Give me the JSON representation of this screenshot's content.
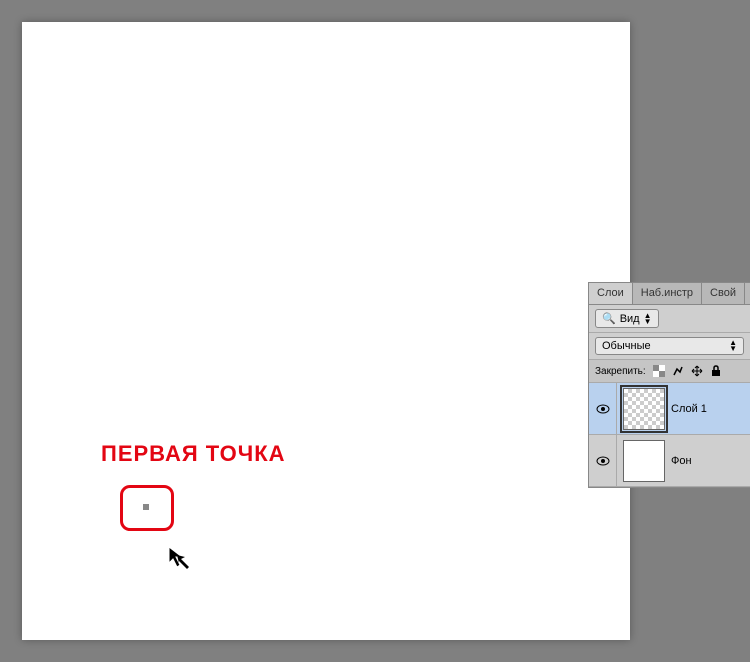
{
  "annotation": {
    "text": "ПЕРВАЯ ТОЧКА"
  },
  "panel": {
    "tabs": [
      "Слои",
      "Наб.инстр",
      "Свой"
    ],
    "active_tab": 0,
    "kind_filter": "Вид",
    "blend_mode": "Обычные",
    "lock_label": "Закрепить:",
    "layers": [
      {
        "name": "Слой 1",
        "visible": true,
        "type": "transparent",
        "selected": true
      },
      {
        "name": "Фон",
        "visible": true,
        "type": "white",
        "selected": false
      }
    ]
  }
}
